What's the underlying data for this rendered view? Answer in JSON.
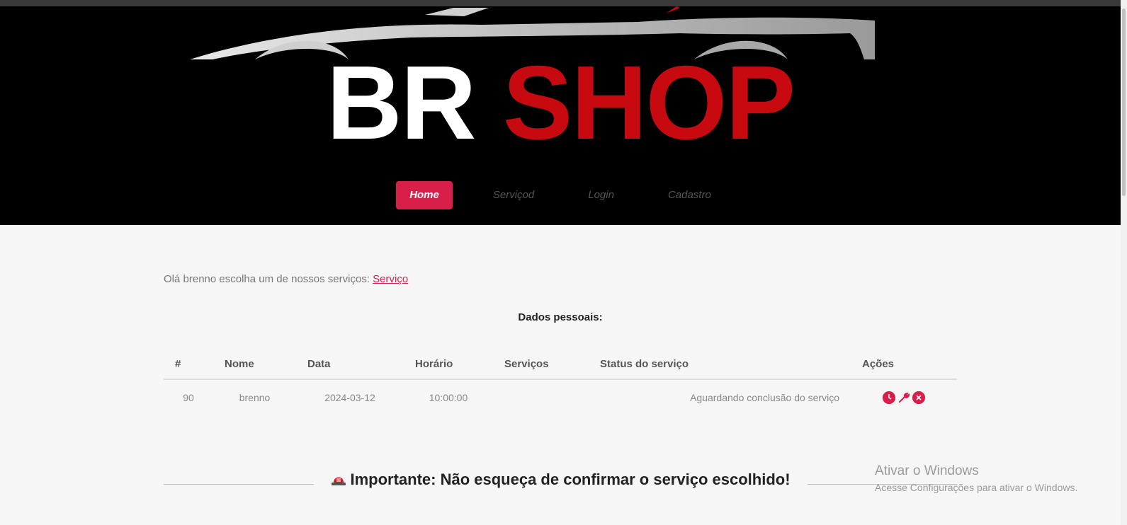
{
  "brand": {
    "part1": "BR",
    "part2": "SHOP"
  },
  "nav": {
    "items": [
      {
        "label": "Home",
        "active": true
      },
      {
        "label": "Serviçod",
        "active": false
      },
      {
        "label": "Login",
        "active": false
      },
      {
        "label": "Cadastro",
        "active": false
      }
    ]
  },
  "main": {
    "greeting": "Olá brenno escolha um de nossos serviços:",
    "greeting_link": "Serviço",
    "section_title": "Dados pessoais:",
    "table": {
      "headers": [
        "#",
        "Nome",
        "Data",
        "Horário",
        "Serviços",
        "Status do serviço",
        "Ações"
      ],
      "rows": [
        {
          "id": "90",
          "nome": "brenno",
          "data": "2024-03-12",
          "horario": "10:00:00",
          "servicos": "",
          "status": "Aguardando conclusão do serviço"
        }
      ]
    },
    "important": "Importante: Não esqueça de confirmar o serviço escolhido!"
  },
  "watermark": {
    "title": "Ativar o Windows",
    "subtitle": "Acesse Configurações para ativar o Windows."
  },
  "colors": {
    "accent": "#d81f4a",
    "brand_red": "#c60a10",
    "header_bg": "#000000"
  },
  "icons": [
    "clock-icon",
    "wrench-icon",
    "close-icon",
    "siren-icon"
  ]
}
